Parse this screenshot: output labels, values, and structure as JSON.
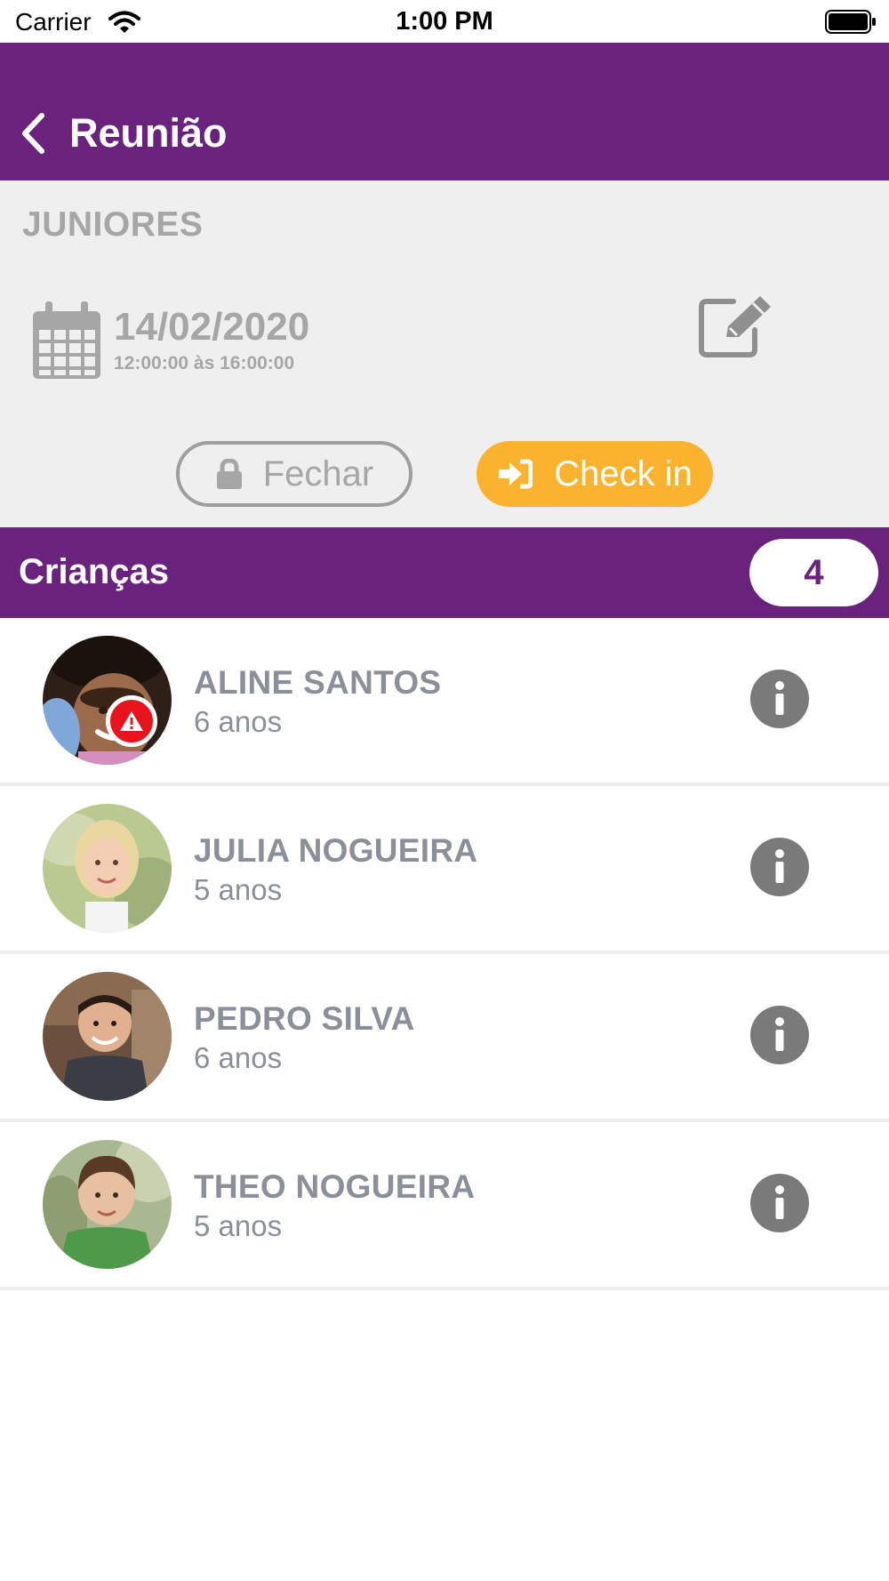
{
  "status_bar": {
    "carrier": "Carrier",
    "time": "1:00 PM"
  },
  "header": {
    "title": "Reunião",
    "back_icon": "chevron-left-icon"
  },
  "meeting": {
    "group": "JUNIORES",
    "date": "14/02/2020",
    "hours": "12:00:00 às 16:00:00",
    "close_label": "Fechar",
    "checkin_label": "Check in"
  },
  "children_section": {
    "title": "Crianças",
    "count": "4"
  },
  "children": [
    {
      "name": "ALINE SANTOS",
      "age": "6 anos",
      "alert": true
    },
    {
      "name": "JULIA NOGUEIRA",
      "age": "5 anos",
      "alert": false
    },
    {
      "name": "PEDRO SILVA",
      "age": "6 anos",
      "alert": false
    },
    {
      "name": "THEO NOGUEIRA",
      "age": "5 anos",
      "alert": false
    }
  ],
  "colors": {
    "primary": "#6a237c",
    "accent": "#fbb32f",
    "panel": "#efefef",
    "alert": "#e8141b",
    "muted_text": "#8a8f99"
  }
}
